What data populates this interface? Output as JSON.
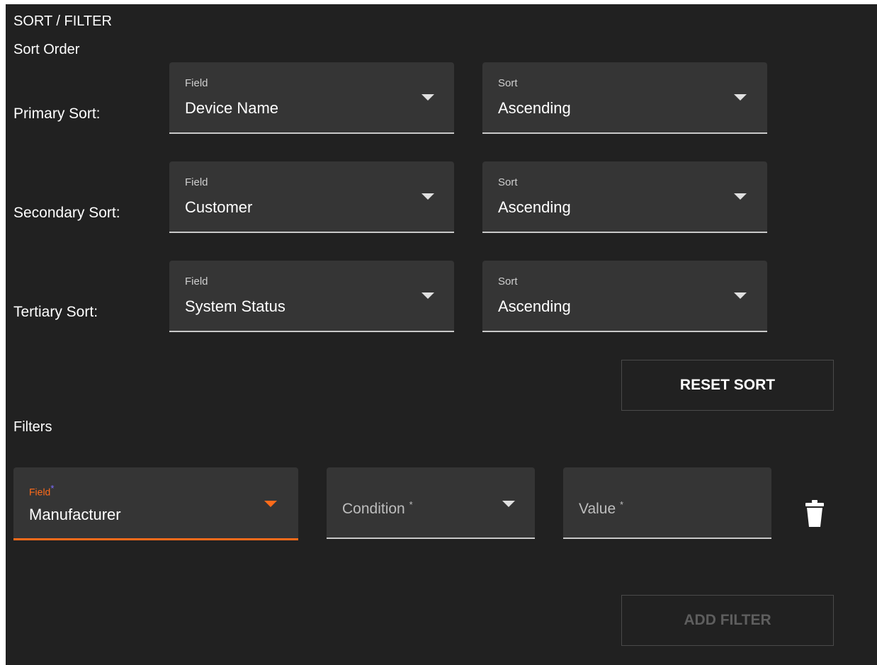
{
  "panel": {
    "title": "SORT / FILTER",
    "sort_order_heading": "Sort Order",
    "filters_heading": "Filters"
  },
  "sort_rows": [
    {
      "row_label": "Primary Sort:",
      "field_label": "Field",
      "field_value": "Device Name",
      "sort_label": "Sort",
      "sort_value": "Ascending"
    },
    {
      "row_label": "Secondary Sort:",
      "field_label": "Field",
      "field_value": "Customer",
      "sort_label": "Sort",
      "sort_value": "Ascending"
    },
    {
      "row_label": "Tertiary Sort:",
      "field_label": "Field",
      "field_value": "System Status",
      "sort_label": "Sort",
      "sort_value": "Ascending"
    }
  ],
  "buttons": {
    "reset_sort": "RESET SORT",
    "add_filter": "ADD FILTER"
  },
  "filter": {
    "field_label": "Field",
    "field_required_mark": "*",
    "field_value": "Manufacturer",
    "condition_placeholder": "Condition",
    "condition_required_mark": "*",
    "value_placeholder": "Value",
    "value_required_mark": "*",
    "delete_icon": "trash-icon"
  },
  "colors": {
    "panel_bg": "#212121",
    "select_bg": "#353535",
    "accent": "#ff6b1a",
    "required_mark": "#7c6cff",
    "disabled_text": "#5e5e5e"
  }
}
